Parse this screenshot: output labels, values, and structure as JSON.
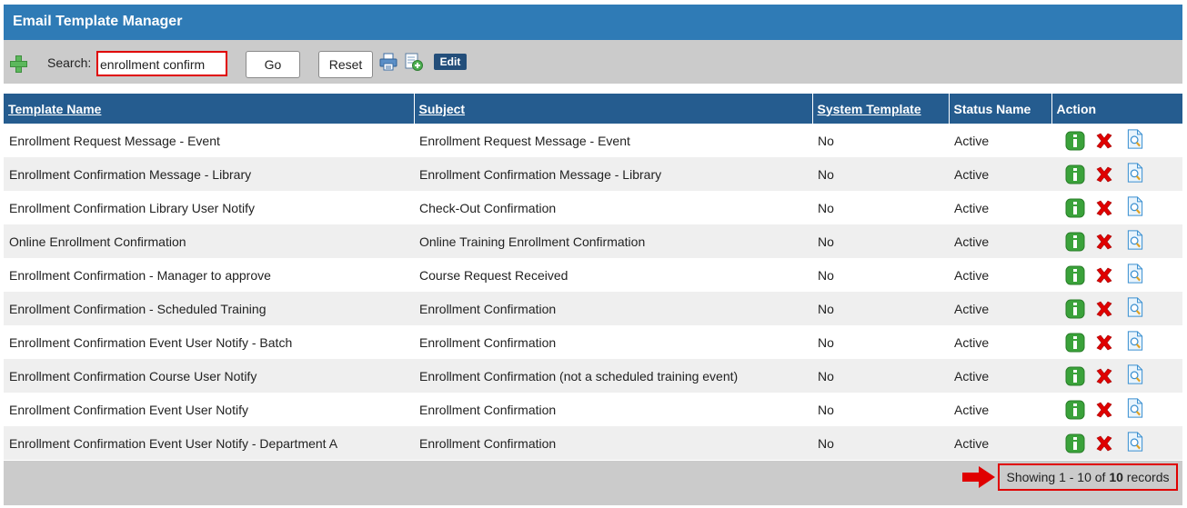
{
  "header": {
    "title": "Email Template Manager"
  },
  "toolbar": {
    "search_label": "Search:",
    "search_value": "enrollment confirm",
    "go_label": "Go",
    "reset_label": "Reset",
    "edit_label": "Edit",
    "icons": [
      "add-icon",
      "print-icon",
      "export-icon"
    ]
  },
  "table": {
    "columns": [
      "Template Name",
      "Subject",
      "System Template",
      "Status Name",
      "Action"
    ],
    "rows": [
      {
        "name": "Enrollment Request Message - Event",
        "subject": "Enrollment Request Message - Event",
        "system": "No",
        "status": "Active"
      },
      {
        "name": "Enrollment Confirmation Message - Library",
        "subject": "Enrollment Confirmation Message - Library",
        "system": "No",
        "status": "Active"
      },
      {
        "name": "Enrollment Confirmation Library User Notify",
        "subject": "Check-Out Confirmation",
        "system": "No",
        "status": "Active"
      },
      {
        "name": "Online Enrollment Confirmation",
        "subject": "Online Training Enrollment Confirmation",
        "system": "No",
        "status": "Active"
      },
      {
        "name": "Enrollment Confirmation - Manager to approve",
        "subject": "Course Request Received",
        "system": "No",
        "status": "Active"
      },
      {
        "name": "Enrollment Confirmation - Scheduled Training",
        "subject": "Enrollment Confirmation",
        "system": "No",
        "status": "Active"
      },
      {
        "name": "Enrollment Confirmation Event User Notify - Batch",
        "subject": "Enrollment Confirmation",
        "system": "No",
        "status": "Active"
      },
      {
        "name": "Enrollment Confirmation Course User Notify",
        "subject": "Enrollment Confirmation (not a scheduled training event)",
        "system": "No",
        "status": "Active"
      },
      {
        "name": "Enrollment Confirmation Event User Notify",
        "subject": "Enrollment Confirmation",
        "system": "No",
        "status": "Active"
      },
      {
        "name": "Enrollment Confirmation Event User Notify - Department A",
        "subject": "Enrollment Confirmation",
        "system": "No",
        "status": "Active"
      }
    ],
    "action_icons": [
      "info-icon",
      "delete-icon",
      "preview-icon"
    ]
  },
  "footer": {
    "records_prefix": "Showing 1 - 10 of ",
    "records_total": "10",
    "records_suffix": " records"
  },
  "colors": {
    "header_bg": "#2f7bb6",
    "column_header_bg": "#255c8f",
    "toolbar_bg": "#cbcbcb",
    "highlight": "#e00000",
    "info_green": "#3aa23a",
    "delete_red": "#e00000"
  }
}
